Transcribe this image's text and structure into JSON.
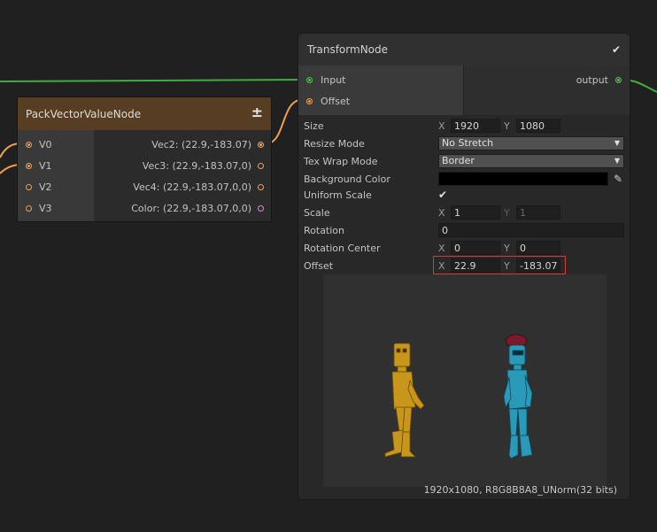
{
  "pack_node": {
    "title": "PackVectorValueNode",
    "header_icon": "plus-minus-icon",
    "inputs": [
      {
        "label": "V0",
        "connected": true
      },
      {
        "label": "V1",
        "connected": true
      },
      {
        "label": "V2",
        "connected": false
      },
      {
        "label": "V3",
        "connected": false
      }
    ],
    "outputs": [
      {
        "label": "Vec2: (22.9,-183.07)",
        "connected": true
      },
      {
        "label": "Vec3: (22.9,-183.07,0)",
        "connected": false
      },
      {
        "label": "Vec4: (22.9,-183.07,0,0)",
        "connected": false
      },
      {
        "label": "Color: (22.9,-183.07,0,0)",
        "connected": false
      }
    ]
  },
  "transform_node": {
    "title": "TransformNode",
    "enabled_check": "✔",
    "inputs": [
      {
        "label": "Input"
      },
      {
        "label": "Offset"
      }
    ],
    "output": {
      "label": "output"
    },
    "properties": {
      "size": {
        "label": "Size",
        "x_axis": "X",
        "x": "1920",
        "y_axis": "Y",
        "y": "1080"
      },
      "resize_mode": {
        "label": "Resize Mode",
        "value": "No Stretch"
      },
      "tex_wrap_mode": {
        "label": "Tex Wrap Mode",
        "value": "Border"
      },
      "background_color": {
        "label": "Background Color",
        "value": "#000000"
      },
      "uniform_scale": {
        "label": "Uniform Scale",
        "checked": "✔"
      },
      "scale": {
        "label": "Scale",
        "x_axis": "X",
        "x": "1",
        "y_axis": "Y",
        "y": "1"
      },
      "rotation": {
        "label": "Rotation",
        "value": "0"
      },
      "rotation_center": {
        "label": "Rotation Center",
        "x_axis": "X",
        "x": "0",
        "y_axis": "Y",
        "y": "0"
      },
      "offset": {
        "label": "Offset",
        "x_axis": "X",
        "x": "22.9",
        "y_axis": "Y",
        "y": "-183.07"
      }
    },
    "status": "1920x1080, R8G8B8A8_UNorm(32 bits)"
  },
  "colors": {
    "edge_orange": "#f0a050",
    "edge_green": "#3fae3f",
    "pack_header": "#573e23",
    "highlight": "#d43a3a",
    "figure_gold": "#c8961a",
    "figure_cyan": "#2a9ab8"
  }
}
